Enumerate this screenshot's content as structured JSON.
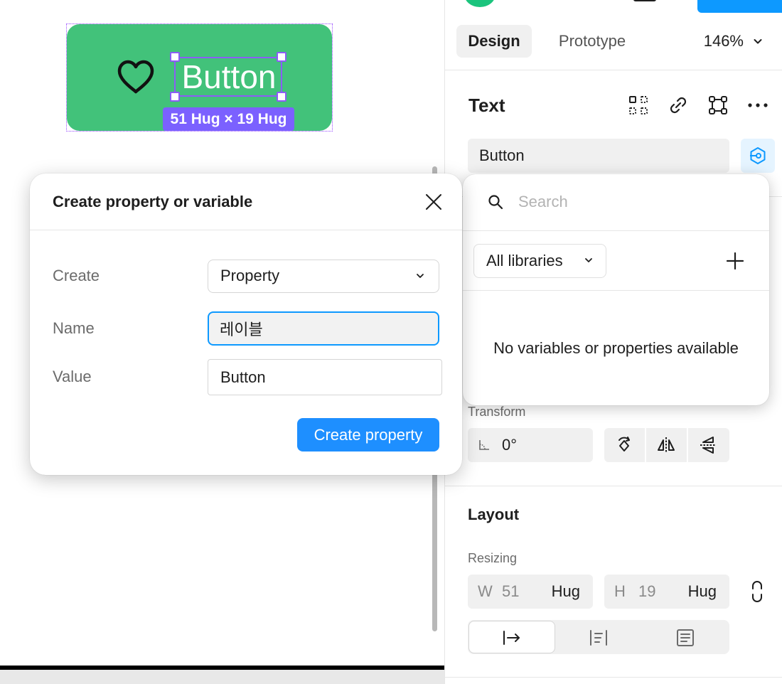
{
  "canvas": {
    "component_label": "Button",
    "size_badge": "51 Hug × 19 Hug"
  },
  "panel": {
    "tabs": [
      {
        "label": "Design",
        "active": true
      },
      {
        "label": "Prototype",
        "active": false
      }
    ],
    "zoom": "146%",
    "section_title": "Text",
    "text_value": "Button",
    "transform_label": "Transform",
    "rotation": "0°",
    "layout_title": "Layout",
    "resizing_label": "Resizing",
    "width": {
      "letter": "W",
      "value": "51",
      "mode": "Hug"
    },
    "height": {
      "letter": "H",
      "value": "19",
      "mode": "Hug"
    }
  },
  "variables_popover": {
    "search_placeholder": "Search",
    "library_select": "All libraries",
    "empty_message": "No variables or properties available"
  },
  "modal": {
    "title": "Create property or variable",
    "create_label": "Create",
    "create_value": "Property",
    "name_label": "Name",
    "name_value": "레이블",
    "value_label": "Value",
    "value_value": "Button",
    "submit_label": "Create property"
  },
  "colors": {
    "component_fill": "#42c27a",
    "selection": "#8c5cf6",
    "accent": "#0d99ff",
    "primary_button": "#1e8fff"
  }
}
